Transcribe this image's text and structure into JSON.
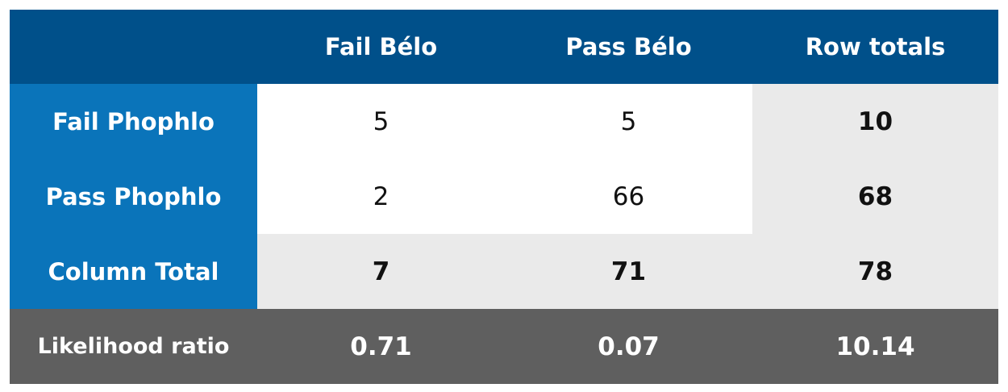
{
  "table": {
    "header": {
      "corner": "",
      "columns": [
        "Fail Bélo",
        "Pass Bélo",
        "Row totals"
      ]
    },
    "rows": [
      {
        "label": "Fail Phophlo",
        "values": [
          "5",
          "5"
        ],
        "total": "10"
      },
      {
        "label": "Pass Phophlo",
        "values": [
          "2",
          "66"
        ],
        "total": "68"
      },
      {
        "label": "Column Total",
        "values": [
          "7",
          "71"
        ],
        "total": "78"
      }
    ],
    "likelihood": {
      "label": "Likelihood ratio",
      "values": [
        "0.71",
        "0.07",
        "10.14"
      ]
    }
  },
  "colors": {
    "header_bg": "#00508a",
    "row_header_bg": "#0a74ba",
    "body_white": "#ffffff",
    "body_grey": "#eaeaea",
    "footer_bg": "#5f5f5f"
  }
}
